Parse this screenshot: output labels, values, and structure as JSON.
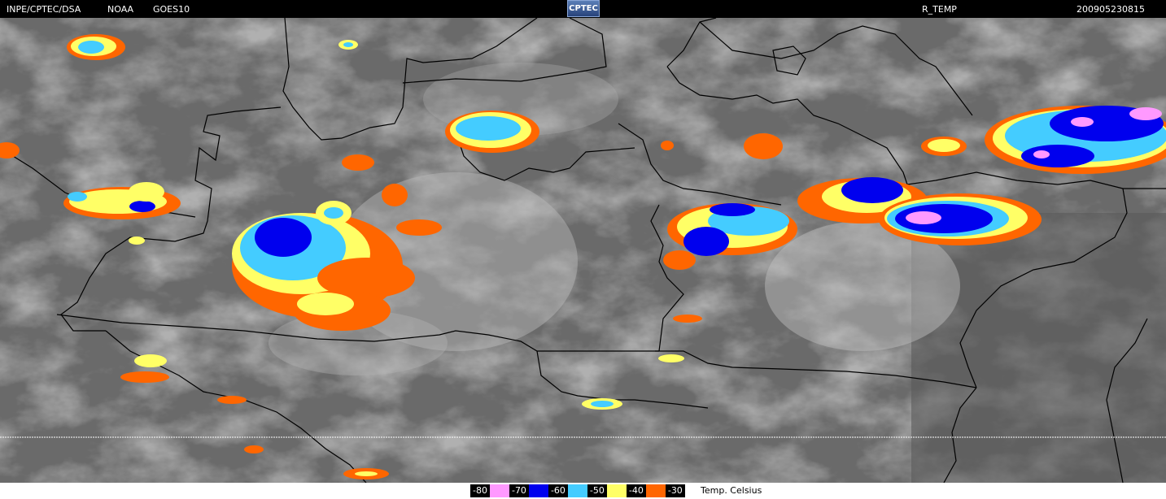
{
  "header": {
    "agency": "INPE/CPTEC/DSA",
    "source": "NOAA",
    "satellite": "GOES10",
    "logo": "CPTEC",
    "product": "R_TEMP",
    "timestamp": "200905230815"
  },
  "legend": {
    "items": [
      {
        "label": "-80",
        "color": "#ff99ff"
      },
      {
        "label": "-70",
        "color": "#0000ee"
      },
      {
        "label": "-60",
        "color": "#44ccff"
      },
      {
        "label": "-50",
        "color": "#ffff66"
      },
      {
        "label": "-40",
        "color": "#ff6600"
      },
      {
        "label": "-30"
      }
    ],
    "unit": "Temp. Celsius"
  },
  "colors": {
    "background": "#000000",
    "cloud_gray": "#6e6e6e",
    "border_lines": "#000000"
  },
  "icons": {
    "logo": "cptec-logo"
  }
}
